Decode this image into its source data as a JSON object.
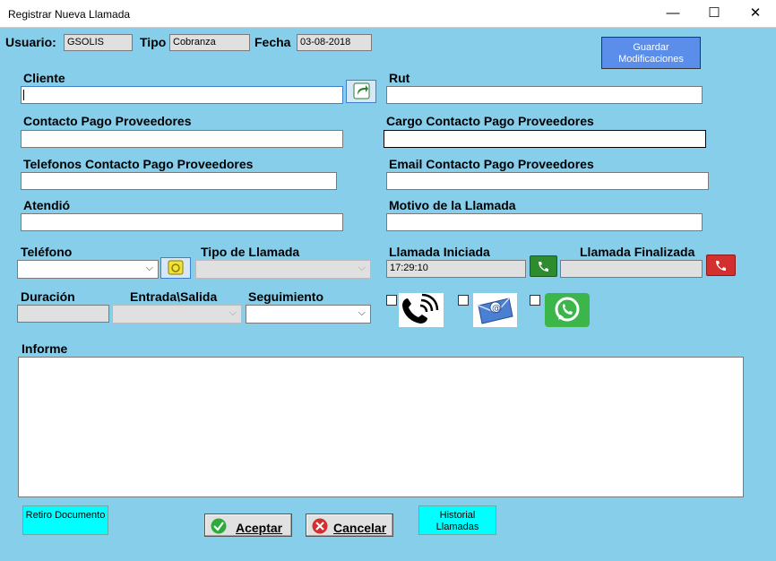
{
  "window": {
    "title": "Registrar Nueva Llamada",
    "minimize": "—",
    "maximize": "☐",
    "close": "✕"
  },
  "header": {
    "usuario_label": "Usuario:",
    "usuario_value": "GSOLIS",
    "tipo_label": "Tipo",
    "tipo_value": "Cobranza",
    "fecha_label": "Fecha",
    "fecha_value": "03-08-2018",
    "save_button": "Guardar Modificaciones"
  },
  "fields": {
    "cliente_label": "Cliente",
    "cliente_value": "",
    "rut_label": "Rut",
    "rut_value": "",
    "contacto_label": "Contacto Pago Proveedores",
    "contacto_value": "",
    "cargo_label": "Cargo Contacto Pago Proveedores",
    "cargo_value": "",
    "telefonos_label": "Telefonos Contacto Pago Proveedores",
    "telefonos_value": "",
    "email_label": "Email Contacto Pago Proveedores",
    "email_value": "",
    "atendio_label": "Atendió",
    "atendio_value": "",
    "motivo_label": "Motivo de la Llamada",
    "motivo_value": "",
    "telefono_label": "Teléfono",
    "telefono_value": "",
    "tipo_llamada_label": "Tipo de Llamada",
    "tipo_llamada_value": "",
    "iniciada_label": "Llamada Iniciada",
    "iniciada_value": "17:29:10",
    "finalizada_label": "Llamada Finalizada",
    "finalizada_value": "",
    "duracion_label": "Duración",
    "duracion_value": "",
    "entrada_label": "Entrada\\Salida",
    "entrada_value": "",
    "seguimiento_label": "Seguimiento",
    "seguimiento_value": "",
    "informe_label": "Informe",
    "informe_value": ""
  },
  "channels": {
    "phone_checked": false,
    "email_checked": false,
    "whatsapp_checked": false
  },
  "buttons": {
    "retiro": "Retiro Documento",
    "aceptar": "Aceptar",
    "cancelar": "Cancelar",
    "historial": "Historial Llamadas"
  },
  "colors": {
    "background": "#87ceeb",
    "save_button": "#5b8dea",
    "cyan_button": "#00ffff"
  }
}
